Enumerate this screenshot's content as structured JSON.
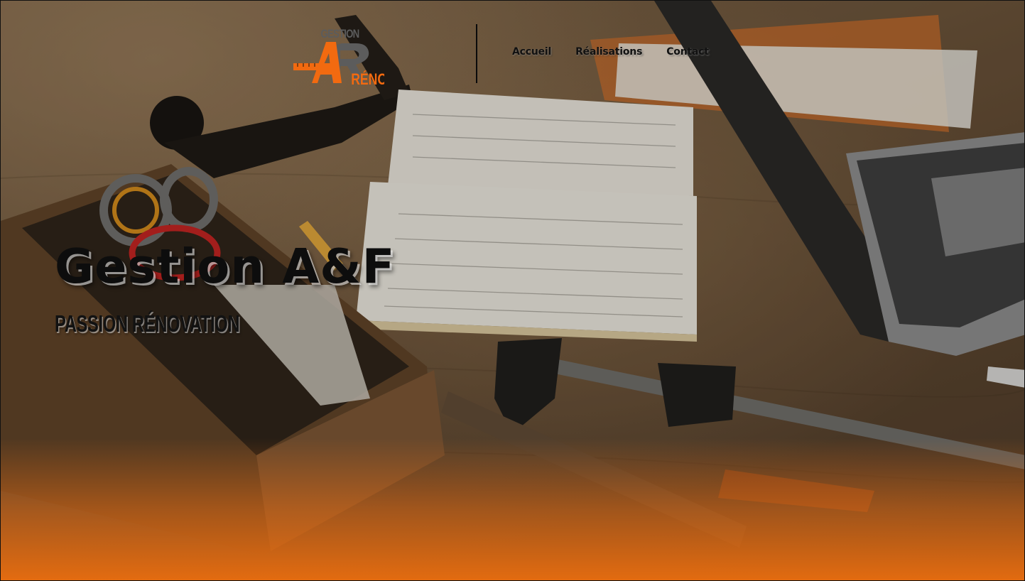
{
  "logo": {
    "line1": "GESTION",
    "monogram": "AF",
    "line2": "RÉNO",
    "accent_color": "#f26a10",
    "dark_color": "#5a5a5a"
  },
  "nav": {
    "items": [
      {
        "label": "Accueil"
      },
      {
        "label": "Réalisations"
      },
      {
        "label": "Contact"
      }
    ]
  },
  "hero": {
    "title": "Gestion A&F",
    "subtitle": "PASSION RÉNOVATION",
    "background": "workshop-desk-photo",
    "bottom_gradient_color": "#eb6e0f"
  }
}
